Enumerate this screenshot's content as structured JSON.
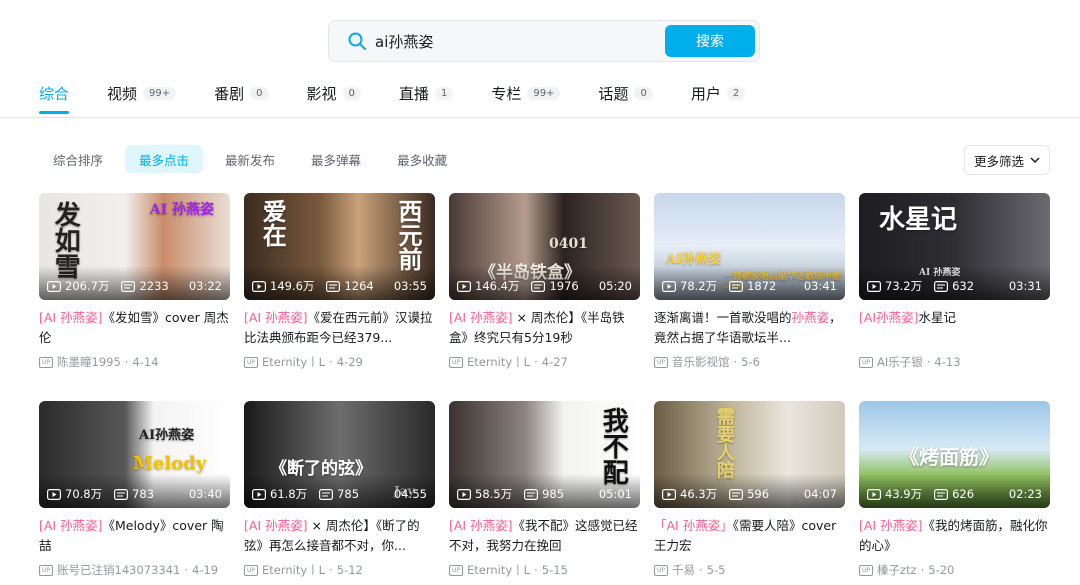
{
  "search": {
    "value": "ai孙燕姿",
    "button": "搜索"
  },
  "tabs": [
    {
      "label": "综合",
      "count": ""
    },
    {
      "label": "视频",
      "count": "99+"
    },
    {
      "label": "番剧",
      "count": "0"
    },
    {
      "label": "影视",
      "count": "0"
    },
    {
      "label": "直播",
      "count": "1"
    },
    {
      "label": "专栏",
      "count": "99+"
    },
    {
      "label": "话题",
      "count": "0"
    },
    {
      "label": "用户",
      "count": "2"
    }
  ],
  "filters": [
    "综合排序",
    "最多点击",
    "最新发布",
    "最多弹幕",
    "最多收藏"
  ],
  "more_filter": "更多筛选",
  "up_badge": "UP",
  "videos": [
    {
      "views": "206.7万",
      "danmaku": "2233",
      "duration": "03:22",
      "title_kw": "[AI 孙燕姿]",
      "title_rest": "《发如雪》cover 周杰伦",
      "author": "陈墨瞳1995",
      "date": "4-14",
      "thumb_text": "发如雪",
      "thumb_text2": "AI 孙燕姿"
    },
    {
      "views": "149.6万",
      "danmaku": "1264",
      "duration": "03:55",
      "title_kw": "[AI 孙燕姿]",
      "title_rest": "《爱在西元前》汉谟拉比法典颁布距今已经379...",
      "author": "Eternity丨L",
      "date": "4-29",
      "thumb_text": "爱在",
      "thumb_text2": "西元前"
    },
    {
      "views": "146.4万",
      "danmaku": "1976",
      "duration": "05:20",
      "title_kw": "[AI 孙燕姿]",
      "title_rest": " × 周杰伦】《半岛铁盒》终究只有5分19秒",
      "author": "Eternity丨L",
      "date": "4-27",
      "thumb_text": "《半岛铁盒》",
      "thumb_text2": "0401"
    },
    {
      "views": "78.2万",
      "danmaku": "1872",
      "duration": "03:41",
      "title_pre": "逐渐离谱！一首歌没唱的",
      "title_kw": "孙燕姿",
      "title_rest": "，竟然占据了华语歌坛半...",
      "author": "音乐影视馆",
      "date": "5-6",
      "thumb_text": "AI孙燕姿",
      "thumb_text2": "一首歌没唱占据华语歌坛半壁江山"
    },
    {
      "views": "73.2万",
      "danmaku": "632",
      "duration": "03:31",
      "title_kw": "[AI孙燕姿]",
      "title_rest": "水星记",
      "author": "AI乐子银",
      "date": "4-13",
      "thumb_text": "水星记",
      "thumb_text2": "AI 孙燕姿"
    },
    {
      "views": "70.8万",
      "danmaku": "783",
      "duration": "03:40",
      "title_kw": "[AI 孙燕姿]",
      "title_rest": "《Melody》cover 陶喆",
      "author": "账号已注销143073341",
      "date": "4-19",
      "thumb_text": "AI孙燕姿",
      "thumb_text2": "Melody"
    },
    {
      "views": "61.8万",
      "danmaku": "785",
      "duration": "04:55",
      "title_kw": "[AI 孙燕姿]",
      "title_rest": " × 周杰伦】《断了的弦》再怎么接音都不对，你...",
      "author": "Eternity丨L",
      "date": "5-12",
      "thumb_text": "《断了的弦》",
      "thumb_text2": "Jay"
    },
    {
      "views": "58.5万",
      "danmaku": "985",
      "duration": "05:01",
      "title_kw": "[AI 孙燕姿]",
      "title_rest": "《我不配》这感觉已经不对，我努力在挽回",
      "author": "Eternity丨L",
      "date": "5-15",
      "thumb_text": "我不配",
      "thumb_text2": ""
    },
    {
      "views": "46.3万",
      "danmaku": "596",
      "duration": "04:07",
      "title_kw": "「AI 孙燕姿」",
      "title_rest": "《需要人陪》cover 王力宏",
      "author": "千易",
      "date": "5-5",
      "thumb_text": "需要人陪",
      "thumb_text2": ""
    },
    {
      "views": "43.9万",
      "danmaku": "626",
      "duration": "02:23",
      "title_kw": "[AI 孙燕姿]",
      "title_rest": "《我的烤面筋，融化你的心》",
      "author": "榛子ztz",
      "date": "5-20",
      "thumb_text": "《烤面筋》",
      "thumb_text2": ""
    }
  ],
  "colors": {
    "accent": "#00aeec",
    "keyword": "#f25d8e"
  }
}
